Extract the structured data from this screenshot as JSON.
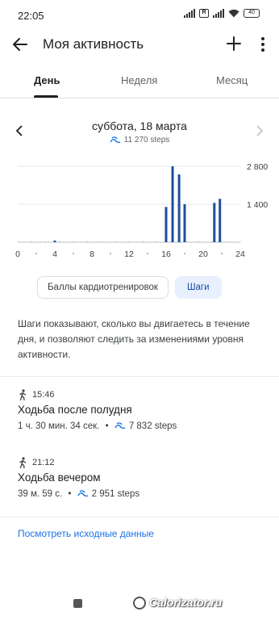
{
  "status_bar": {
    "time": "22:05",
    "icon_box": "R",
    "battery": "40"
  },
  "app_bar": {
    "title": "Моя активность",
    "back_icon": "arrow-left-icon",
    "add_icon": "plus-icon",
    "more_icon": "more-vertical-icon"
  },
  "tabs": [
    {
      "label": "День",
      "active": true
    },
    {
      "label": "Неделя",
      "active": false
    },
    {
      "label": "Месяц",
      "active": false
    }
  ],
  "date_nav": {
    "date": "суббота, 18 марта",
    "steps": "11 270 steps"
  },
  "chart_data": {
    "type": "bar",
    "x": [
      4,
      16,
      16.7,
      17.4,
      18,
      21.2,
      21.8
    ],
    "values": [
      60,
      1300,
      2800,
      2500,
      1400,
      1450,
      1600
    ],
    "xticks": [
      "0",
      "4",
      "8",
      "12",
      "16",
      "20",
      "24"
    ],
    "yticks": [
      "1 400",
      "2 800"
    ],
    "xlim": [
      0,
      24
    ],
    "ylim": [
      0,
      2800
    ],
    "grid": true,
    "color": "#1f4e9c"
  },
  "chips": [
    {
      "label": "Баллы кардиотренировок",
      "selected": false
    },
    {
      "label": "Шаги",
      "selected": true
    }
  ],
  "description": "Шаги показывают, сколько вы двигаетесь в течение дня, и позволяют следить за изменениями уровня активности.",
  "activities": [
    {
      "time": "15:46",
      "title": "Ходьба после полудня",
      "duration": "1 ч. 30 мин. 34 сек.",
      "steps": "7 832 steps"
    },
    {
      "time": "21:12",
      "title": "Ходьба вечером",
      "duration": "39 м. 59 с.",
      "steps": "2 951 steps"
    }
  ],
  "link": "Посмотреть исходные данные",
  "watermark": "Calorizator.ru",
  "colors": {
    "accent": "#1a73e8",
    "bar": "#1f4e9c",
    "chip_selected_bg": "#e8f0fe"
  }
}
